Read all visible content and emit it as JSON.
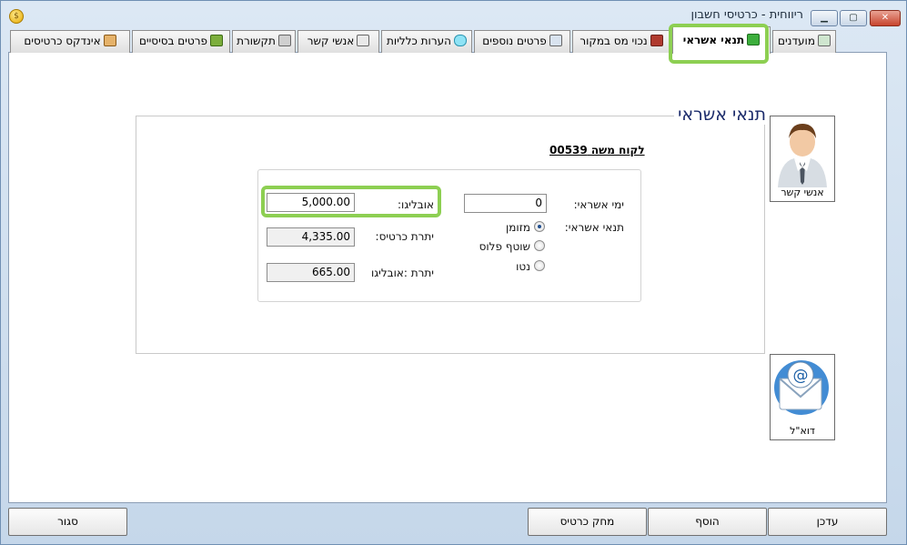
{
  "window": {
    "title": "ריווחית - כרטיסי חשבון"
  },
  "tabs": [
    {
      "label": "מועדנים",
      "icon": "chart-icon"
    },
    {
      "label": "תנאי אשראי",
      "icon": "money-icon",
      "active": true
    },
    {
      "label": "נכוי מס במקור",
      "icon": "tax-icon"
    },
    {
      "label": "פרטים נוספים",
      "icon": "notepad-icon"
    },
    {
      "label": "הערות כלליות",
      "icon": "info-icon"
    },
    {
      "label": "אנשי קשר",
      "icon": "contacts-icon"
    },
    {
      "label": "תקשורת",
      "icon": "phone-icon"
    },
    {
      "label": "פרטים בסיסיים",
      "icon": "book-icon"
    },
    {
      "label": "אינדקס כרטיסים",
      "icon": "index-icon"
    }
  ],
  "credit": {
    "title": "תנאי אשראי",
    "customer": "לקוח משה 00539",
    "credit_days_label": "ימי אשראי:",
    "credit_days_value": "0",
    "credit_terms_label": "תנאי אשראי:",
    "options": [
      "מזומן",
      "שוטף פלוס",
      "נטו"
    ],
    "selected_option": "מזומן",
    "obligo_label": "אובליגו:",
    "obligo_value": "5,000.00",
    "card_balance_label": "יתרת כרטיס:",
    "card_balance_value": "4,335.00",
    "obligo_balance_label": "יתרת :אובליגו",
    "obligo_balance_value": "665.00"
  },
  "side": {
    "contacts_label": "אנשי קשר",
    "email_label": "דוא\"ל"
  },
  "buttons": {
    "update": "עדכן",
    "add": "הוסף",
    "delete": "מחק כרטיס",
    "close": "סגור"
  },
  "colors": {
    "highlight": "#8dcf52",
    "title": "#1a2a6a"
  }
}
